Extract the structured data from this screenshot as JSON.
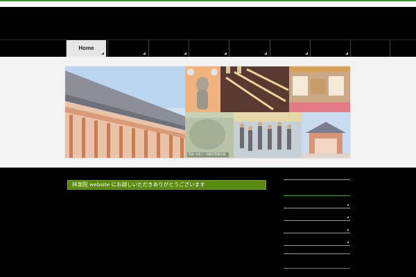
{
  "nav": {
    "items": [
      {
        "label": "Home",
        "active": true
      },
      {
        "label": "",
        "active": false
      },
      {
        "label": "",
        "active": false
      },
      {
        "label": "",
        "active": false
      },
      {
        "label": "",
        "active": false
      },
      {
        "label": "",
        "active": false
      },
      {
        "label": "",
        "active": false
      },
      {
        "label": "",
        "active": false
      }
    ]
  },
  "banner": {
    "caption": "国宝 木造十一面観音菩薩立像"
  },
  "main": {
    "welcome_title": "祥泉院 website にお越しいただきありがとうございます"
  },
  "colors": {
    "accent_green": "#5a8a0f",
    "nav_active": "#e6e6e6",
    "background": "#000000"
  }
}
